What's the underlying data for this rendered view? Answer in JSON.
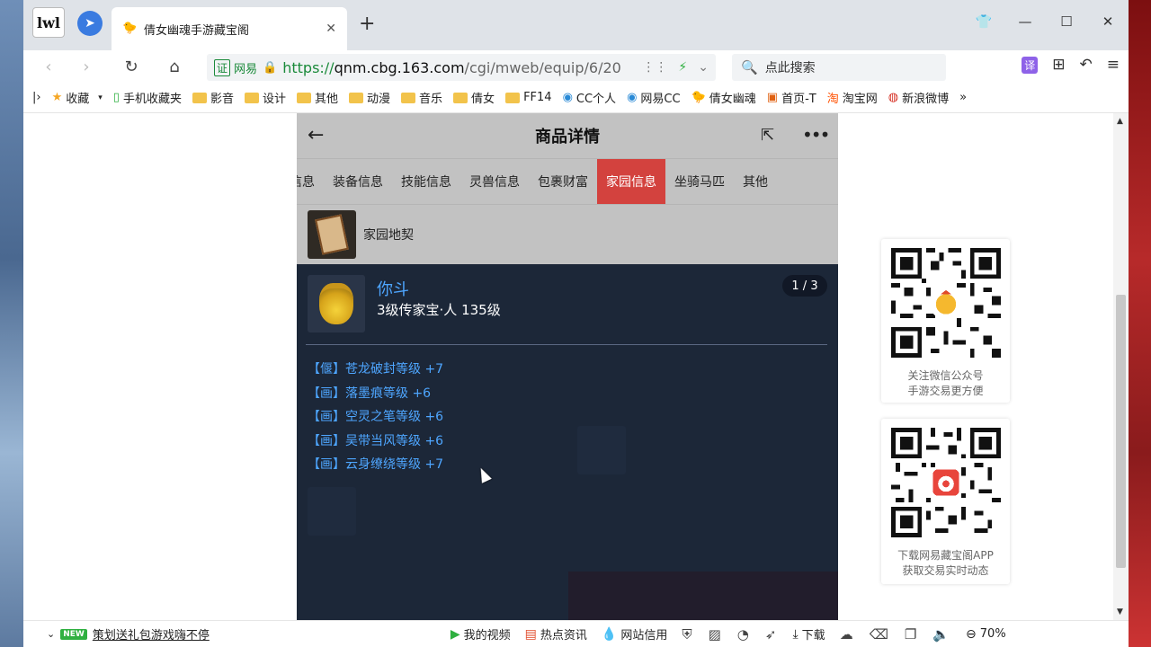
{
  "browser": {
    "logo_text": "lwl",
    "tab": {
      "title": "倩女幽魂手游藏宝阁",
      "favicon": "chick-icon"
    },
    "window_controls": [
      "shirt-icon",
      "minimize-icon",
      "maximize-icon",
      "close-icon"
    ],
    "address": {
      "cert_badge": "证",
      "verified_label": "网易",
      "https": "https://",
      "host": "qnm.cbg.163.com",
      "path": "/cgi/mweb/equip/6/20"
    },
    "search_placeholder": "点此搜索",
    "translate_label": "译"
  },
  "bookmarks": [
    {
      "label": "收藏",
      "icon": "star-icon"
    },
    {
      "label": "手机收藏夹",
      "icon": "phone-icon"
    },
    {
      "label": "影音",
      "icon": "folder-icon"
    },
    {
      "label": "设计",
      "icon": "folder-icon"
    },
    {
      "label": "其他",
      "icon": "folder-icon"
    },
    {
      "label": "动漫",
      "icon": "folder-icon"
    },
    {
      "label": "音乐",
      "icon": "folder-icon"
    },
    {
      "label": "倩女",
      "icon": "folder-icon"
    },
    {
      "label": "FF14",
      "icon": "folder-icon"
    },
    {
      "label": "CC个人",
      "icon": "cc-icon"
    },
    {
      "label": "网易CC",
      "icon": "cc-icon"
    },
    {
      "label": "倩女幽魂",
      "icon": "chick-icon"
    },
    {
      "label": "首页-T",
      "icon": "site-icon"
    },
    {
      "label": "淘宝网",
      "icon": "taobao-icon"
    },
    {
      "label": "新浪微博",
      "icon": "weibo-icon"
    }
  ],
  "page": {
    "header_title": "商品详情",
    "tabs": [
      "信息",
      "装备信息",
      "技能信息",
      "灵兽信息",
      "包裹财富",
      "家园信息",
      "坐骑马匹",
      "其他"
    ],
    "active_tab": "家园信息",
    "deed_label": "家园地契",
    "item": {
      "name": "你斗",
      "subtitle": "3级传家宝·人  135级",
      "pager": "1 / 3",
      "attributes": [
        "【偃】苍龙破封等级 +7",
        "【画】落墨痕等级 +6",
        "【画】空灵之笔等级 +6",
        "【画】吴带当风等级 +6",
        "【画】云身缭绕等级 +7"
      ]
    }
  },
  "qr_cards": [
    {
      "caption_line1": "关注微信公众号",
      "caption_line2": "手游交易更方便",
      "center_icon": "chick-icon"
    },
    {
      "caption_line1": "下载网易藏宝阁APP",
      "caption_line2": "获取交易实时动态",
      "center_icon": "app-icon"
    }
  ],
  "statusbar": {
    "news_badge": "NEW",
    "news_text": "策划送礼包游戏嗨不停",
    "items": [
      "我的视频",
      "热点资讯",
      "网站信用"
    ],
    "download": "下载",
    "zoom": "70%"
  }
}
